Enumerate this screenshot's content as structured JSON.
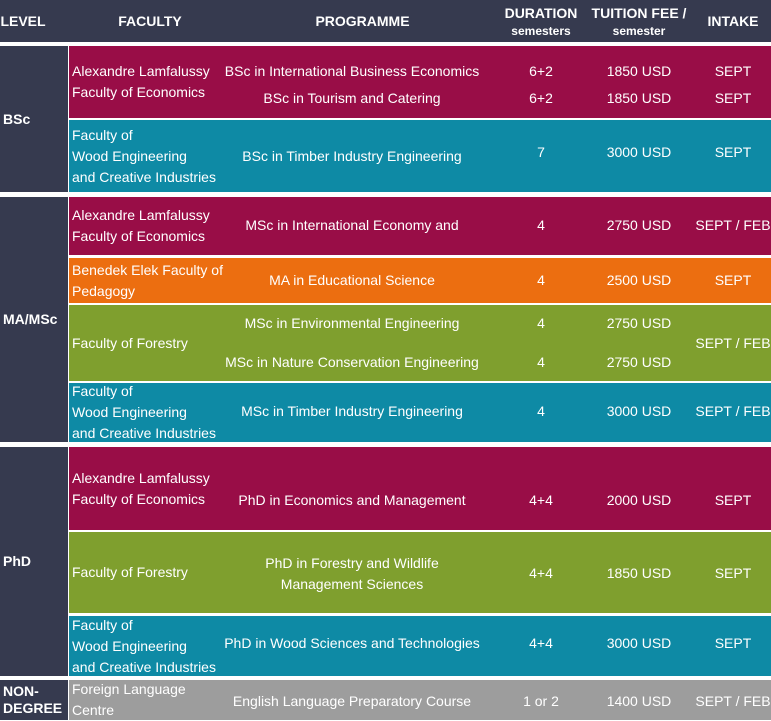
{
  "headers": {
    "level": "LEVEL",
    "faculty": "FACULTY",
    "programme": "PROGRAMME",
    "duration": "DURATION",
    "duration_sub": "semesters",
    "tuition": "TUITION FEE /",
    "tuition_sub": "semester",
    "intake": "INTAKE"
  },
  "levels": {
    "bsc": "BSc",
    "ma": "MA/MSc",
    "phd": "PhD",
    "nondegree_1": "NON-",
    "nondegree_2": "DEGREE"
  },
  "faculties": {
    "econ_1": "Alexandre Lamfalussy",
    "econ_2": "Faculty of Economics",
    "wood_1": "Faculty of",
    "wood_2": "Wood Engineering",
    "wood_3": "and Creative Industries",
    "ped_1": "Benedek Elek Faculty of",
    "ped_2": "Pedagogy",
    "forestry": "Faculty of Forestry",
    "lang_1": "Foreign Language",
    "lang_2": "Centre"
  },
  "rows": {
    "bsc_ibe": {
      "programme": "BSc in International Business Economics",
      "duration": "6+2",
      "fee": "1850 USD",
      "intake": "SEPT"
    },
    "bsc_tc": {
      "programme": "BSc in Tourism and Catering",
      "duration": "6+2",
      "fee": "1850 USD",
      "intake": "SEPT"
    },
    "bsc_tie": {
      "programme": "BSc in Timber Industry Engineering",
      "duration": "7",
      "fee": "3000 USD",
      "intake": "SEPT"
    },
    "msc_ie": {
      "programme": "MSc in International Economy and",
      "duration": "4",
      "fee": "2750 USD",
      "intake": "SEPT / FEB"
    },
    "ma_es": {
      "programme": "MA in Educational Science",
      "duration": "4",
      "fee": "2500 USD",
      "intake": "SEPT"
    },
    "msc_env": {
      "programme": "MSc in Environmental Engineering",
      "duration": "4",
      "fee": "2750 USD"
    },
    "msc_nce": {
      "programme": "MSc in Nature Conservation Engineering",
      "duration": "4",
      "fee": "2750 USD"
    },
    "forestry_intake": "SEPT / FEB",
    "msc_tie": {
      "programme": "MSc in Timber Industry Engineering",
      "duration": "4",
      "fee": "3000 USD",
      "intake": "SEPT / FEB"
    },
    "phd_em": {
      "programme": "PhD in Economics and Management",
      "duration": "4+4",
      "fee": "2000 USD",
      "intake": "SEPT"
    },
    "phd_fw_1": "PhD in Forestry and Wildlife",
    "phd_fw_2": "Management Sciences",
    "phd_fw": {
      "duration": "4+4",
      "fee": "1850 USD",
      "intake": "SEPT"
    },
    "phd_wst": {
      "programme": "PhD in Wood Sciences and Technologies",
      "duration": "4+4",
      "fee": "3000 USD",
      "intake": "SEPT"
    },
    "elpc": {
      "programme": "English Language Preparatory Course",
      "duration": "1 or 2",
      "fee": "1400 USD",
      "intake": "SEPT / FEB"
    }
  }
}
